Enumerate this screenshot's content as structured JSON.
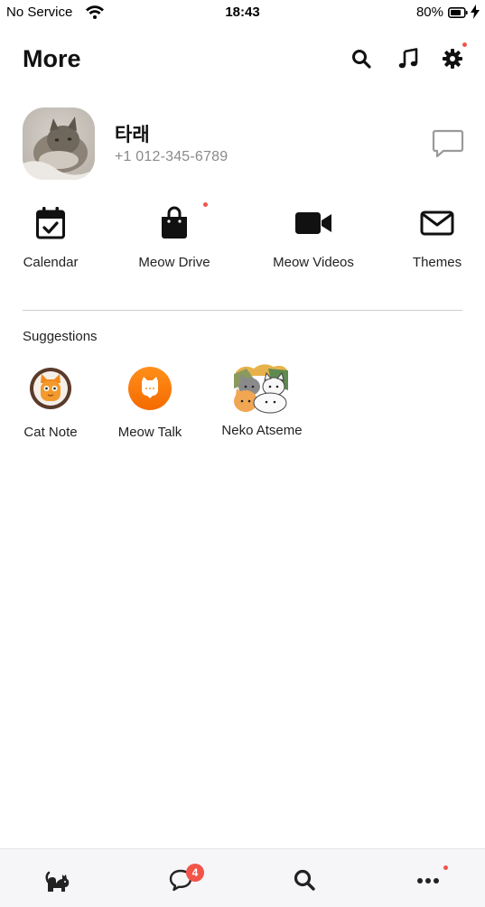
{
  "status_bar": {
    "carrier": "No Service",
    "time": "18:43",
    "battery": "80%"
  },
  "header": {
    "title": "More",
    "icons": [
      "search-icon",
      "music-note-icon",
      "settings-gear-icon"
    ]
  },
  "profile": {
    "name": "타래",
    "phone": "+1 012-345-6789"
  },
  "quick_menu": [
    {
      "label": "Calendar",
      "icon": "calendar-check-icon"
    },
    {
      "label": "Meow Drive",
      "icon": "shopping-bag-icon"
    },
    {
      "label": "Meow Videos",
      "icon": "video-camera-icon"
    },
    {
      "label": "Themes",
      "icon": "envelope-icon"
    }
  ],
  "suggestions": {
    "title": "Suggestions",
    "items": [
      {
        "label": "Cat Note"
      },
      {
        "label": "Meow Talk"
      },
      {
        "label": "Neko Atseme"
      }
    ]
  },
  "tabbar": {
    "tabs": [
      "cat-home-icon",
      "chat-icon",
      "search-icon",
      "more-dots-icon"
    ],
    "chat_badge": "4"
  },
  "colors": {
    "notification_red": "#f2544a",
    "meow_talk_orange": "#ff7a00",
    "tabbar_bg": "#f6f6f8"
  }
}
